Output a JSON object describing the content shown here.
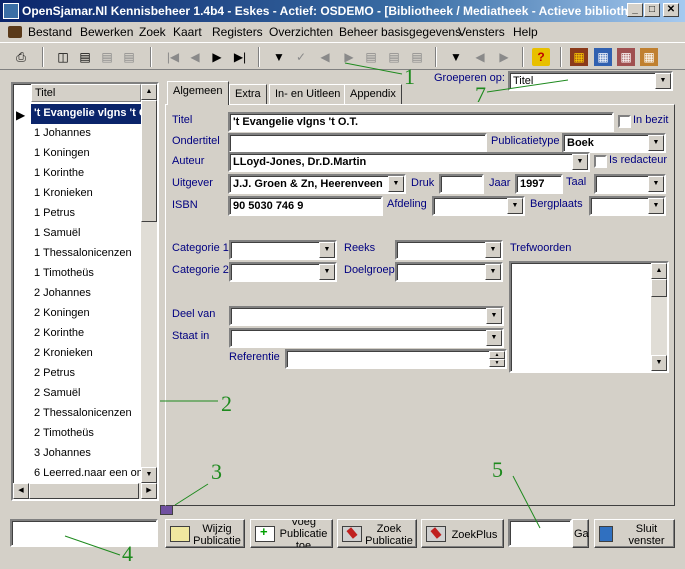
{
  "window": {
    "title": "OpenSjamar.Nl Kennisbeheer 1.4b4 - Eskes - Actief: OSDEMO - [Bibliotheek / Mediatheek - Actieve biblioth...",
    "min_label": "_",
    "max_label": "□",
    "close_label": "✕"
  },
  "menu": {
    "items": [
      "Bestand",
      "Bewerken",
      "Zoek",
      "Kaart",
      "Registers",
      "Overzichten",
      "Beheer basisgegevens",
      "Vensters",
      "Help"
    ]
  },
  "grouping": {
    "label": "Groeperen op:",
    "value": "Titel"
  },
  "list": {
    "header": "Titel",
    "items": [
      "'t Evangelie vlgns 't O.T.",
      "1 Johannes",
      "1 Koningen",
      "1 Korinthe",
      "1 Kronieken",
      "1 Petrus",
      "1 Samuël",
      "1 Thessalonicenzen",
      "1 Timotheüs",
      "2 Johannes",
      "2 Koningen",
      "2 Korinthe",
      "2 Kronieken",
      "2 Petrus",
      "2 Samuël",
      "2 Thessalonicenzen",
      "2 Timotheüs",
      "3 Johannes",
      "6 Leerred.naar een on"
    ],
    "selected_index": 0
  },
  "tabs": [
    "Algemeen",
    "Extra",
    "In- en Uitleen",
    "Appendix"
  ],
  "form": {
    "titel_label": "Titel",
    "titel_value": "'t Evangelie vlgns 't O.T.",
    "in_bezit_label": "In bezit",
    "ondertitel_label": "Ondertitel",
    "ondertitel_value": "",
    "publicatietype_label": "Publicatietype",
    "publicatietype_value": "Boek",
    "auteur_label": "Auteur",
    "auteur_value": "LLoyd-Jones, Dr.D.Martin",
    "is_redacteur_label": "Is redacteur",
    "uitgever_label": "Uitgever",
    "uitgever_value": "J.J. Groen & Zn, Heerenveen",
    "druk_label": "Druk",
    "druk_value": "",
    "jaar_label": "Jaar",
    "jaar_value": "1997",
    "taal_label": "Taal",
    "taal_value": "",
    "isbn_label": "ISBN",
    "isbn_value": "90 5030 746 9",
    "afdeling_label": "Afdeling",
    "afdeling_value": "",
    "bergplaats_label": "Bergplaats",
    "bergplaats_value": "",
    "categorie1_label": "Categorie 1",
    "categorie2_label": "Categorie 2",
    "reeks_label": "Reeks",
    "doelgroep_label": "Doelgroep",
    "trefwoorden_label": "Trefwoorden",
    "deel_van_label": "Deel van",
    "staat_in_label": "Staat in",
    "referentie_label": "Referentie"
  },
  "buttons": {
    "wijzig": "Wijzig Publicatie",
    "voeg": "Voeg Publicatie toe",
    "zoek": "Zoek Publicatie",
    "zoekplus": "ZoekPlus",
    "ga": "Ga",
    "sluit": "Sluit venster"
  },
  "annotations": [
    "1",
    "2",
    "3",
    "4",
    "5",
    "7"
  ],
  "colors": {
    "selection": "#0a246a",
    "label_blue": "#000080",
    "annotation_green": "#1e8a1e",
    "help_icon": "#e8c000"
  }
}
